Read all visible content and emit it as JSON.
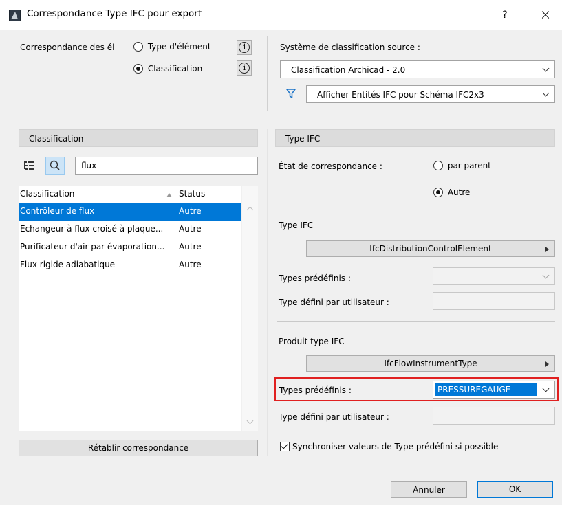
{
  "window": {
    "title": "Correspondance Type IFC pour export",
    "help_label": "?",
    "close_label": "×"
  },
  "mapping": {
    "label": "Correspondance des él",
    "option_element_type": "Type d'élément",
    "option_classification": "Classification",
    "selected": "Classification",
    "info_glyph": "i"
  },
  "source_classification": {
    "label": "Système de classification source :",
    "value": "Classification Archicad - 2.0",
    "filter_value": "Afficher Entités IFC pour Schéma IFC2x3"
  },
  "left_panel": {
    "header": "Classification",
    "search_value": "flux",
    "columns": [
      "Classification",
      "Status"
    ],
    "rows": [
      {
        "name": "Contrôleur de flux",
        "status": "Autre"
      },
      {
        "name": "Echangeur à flux croisé à plaque...",
        "status": "Autre"
      },
      {
        "name": "Purificateur d'air par évaporation...",
        "status": "Autre"
      },
      {
        "name": "Flux rigide adiabatique",
        "status": "Autre"
      }
    ],
    "selected_row": 0,
    "reset_button": "Rétablir correspondance"
  },
  "right_panel": {
    "header": "Type IFC",
    "state_label": "État de correspondance :",
    "option_parent": "par parent",
    "option_other": "Autre",
    "state_selected": "Autre",
    "ifc_type": {
      "label": "Type IFC",
      "value": "IfcDistributionControlElement",
      "predefined_label": "Types prédéfinis :",
      "predefined_value": "",
      "user_defined_label": "Type défini par utilisateur :",
      "user_defined_value": ""
    },
    "product_type": {
      "label": "Produit type IFC",
      "value": "IfcFlowInstrumentType",
      "predefined_label": "Types prédéfinis :",
      "predefined_value": "PRESSUREGAUGE",
      "user_defined_label": "Type défini par utilisateur :",
      "user_defined_value": ""
    },
    "sync_label": "Synchroniser valeurs de Type prédéfini si possible",
    "sync_checked": true
  },
  "footer": {
    "cancel": "Annuler",
    "ok": "OK"
  },
  "colors": {
    "selection": "#0078d7",
    "highlight_border": "#e02020",
    "filter_icon": "#1a73c7"
  }
}
